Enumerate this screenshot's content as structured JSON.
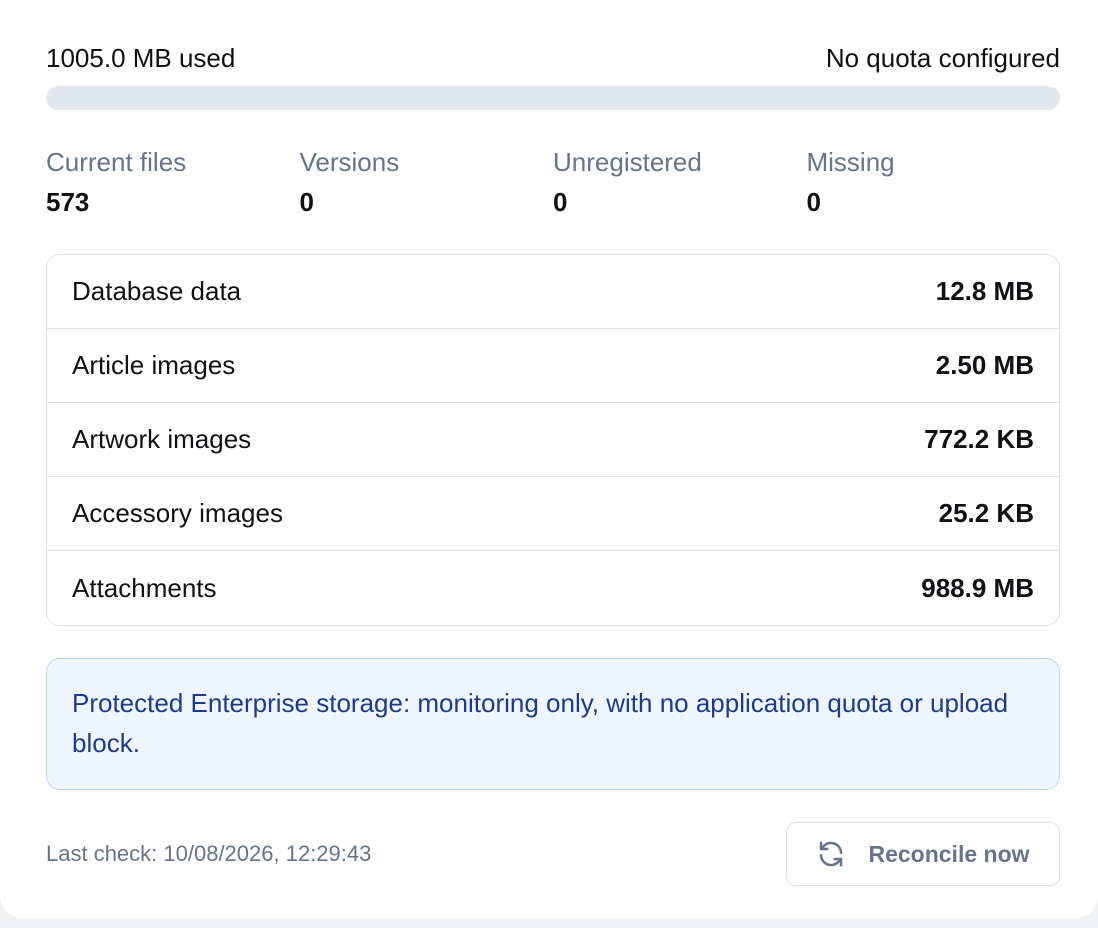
{
  "usage": {
    "used_label": "1005.0 MB used",
    "quota_label": "No quota configured",
    "progress_fraction": 0
  },
  "stats": [
    {
      "label": "Current files",
      "value": "573"
    },
    {
      "label": "Versions",
      "value": "0"
    },
    {
      "label": "Unregistered",
      "value": "0"
    },
    {
      "label": "Missing",
      "value": "0"
    }
  ],
  "breakdown": [
    {
      "label": "Database data",
      "value": "12.8 MB"
    },
    {
      "label": "Article images",
      "value": "2.50 MB"
    },
    {
      "label": "Artwork images",
      "value": "772.2 KB"
    },
    {
      "label": "Accessory images",
      "value": "25.2 KB"
    },
    {
      "label": "Attachments",
      "value": "988.9 MB"
    }
  ],
  "notice": {
    "text": "Protected Enterprise storage: monitoring only, with no application quota or upload block."
  },
  "footer": {
    "last_check": "Last check: 10/08/2026, 12:29:43",
    "reconcile_label": "Reconcile now",
    "reconcile_icon": "refresh-icon"
  },
  "colors": {
    "track": "#e3e8ef",
    "notice_bg": "#eef5fe",
    "notice_text": "#1e3a8a",
    "muted": "#64748b"
  }
}
